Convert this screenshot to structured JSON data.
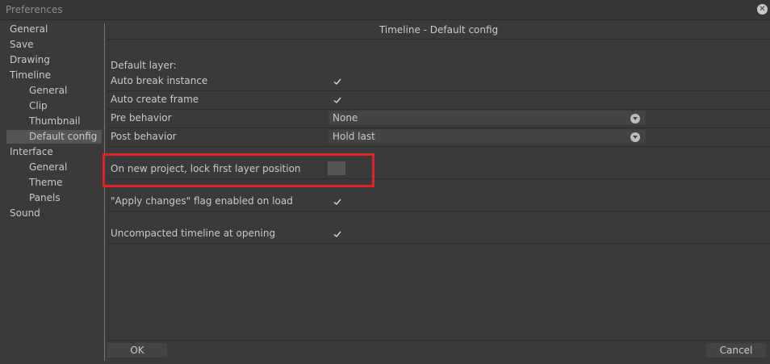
{
  "window": {
    "title": "Preferences"
  },
  "sidebar": {
    "items": [
      {
        "label": "General"
      },
      {
        "label": "Save"
      },
      {
        "label": "Drawing"
      },
      {
        "label": "Timeline"
      },
      {
        "label": "General"
      },
      {
        "label": "Clip"
      },
      {
        "label": "Thumbnail"
      },
      {
        "label": "Default config",
        "selected": true
      },
      {
        "label": "Interface"
      },
      {
        "label": "General"
      },
      {
        "label": "Theme"
      },
      {
        "label": "Panels"
      },
      {
        "label": "Sound"
      }
    ]
  },
  "main": {
    "header": "Timeline - Default config",
    "section_label": "Default layer:",
    "auto_break_instance": {
      "label": "Auto break instance",
      "checked": true
    },
    "auto_create_frame": {
      "label": "Auto create frame",
      "checked": true
    },
    "pre_behavior": {
      "label": "Pre behavior",
      "value": "None"
    },
    "post_behavior": {
      "label": "Post behavior",
      "value": "Hold last"
    },
    "lock_first_layer": {
      "label": "On new project, lock first layer position",
      "checked": false
    },
    "apply_changes": {
      "label": "\"Apply changes\" flag enabled on load",
      "checked": true
    },
    "uncompacted_timeline": {
      "label": "Uncompacted timeline at opening",
      "checked": true
    }
  },
  "buttons": {
    "ok": "OK",
    "cancel": "Cancel"
  },
  "colors": {
    "background": "#3a3a3a",
    "selected": "#555555",
    "highlight": "#e0212a",
    "text": "#c9c9c9"
  },
  "icons": {
    "close": "close-circle-icon",
    "check": "checkmark-icon",
    "dropdown": "chevron-down-circle-icon"
  }
}
